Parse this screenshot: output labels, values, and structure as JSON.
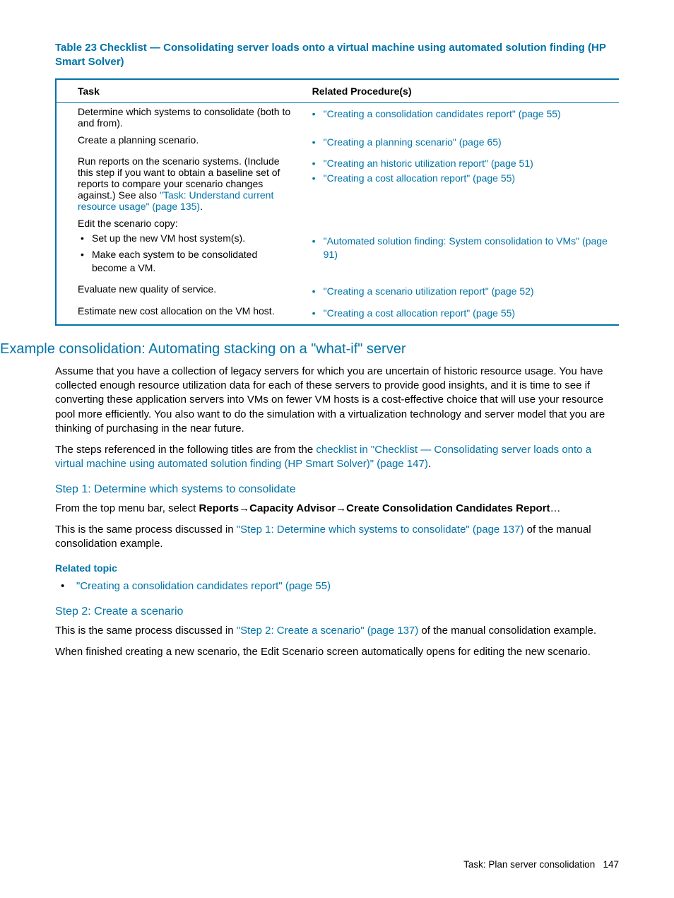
{
  "table": {
    "title": "Table 23 Checklist — Consolidating server loads onto a virtual machine using automated solution finding (HP Smart Solver)",
    "headers": {
      "col1": "Task",
      "col2": "Related Procedure(s)"
    },
    "rows": [
      {
        "task_plain": "Determine which systems to consolidate (both to and from).",
        "procs": [
          {
            "text": "\"Creating a consolidation candidates report\" (page 55)"
          }
        ]
      },
      {
        "task_plain": "Create a planning scenario.",
        "procs": [
          {
            "text": "\"Creating a planning scenario\" (page 65)"
          }
        ]
      },
      {
        "task_pre": "Run reports on the scenario systems. (Include this step if you want to obtain a baseline set of reports to compare your scenario changes against.) See also ",
        "task_link": "\"Task: Understand current resource usage\" (page 135)",
        "task_post": ".",
        "procs": [
          {
            "text": "\"Creating an historic utilization report\" (page 51)"
          },
          {
            "text": "\"Creating a cost allocation report\" (page 55)"
          }
        ]
      },
      {
        "task_plain": "Edit the scenario copy:",
        "sub": [
          "Set up the new VM host system(s).",
          "Make each system to be consolidated become a VM."
        ],
        "procs": [
          {
            "text": "\"Automated solution finding: System consolidation to VMs\" (page 91)"
          }
        ]
      },
      {
        "task_plain": "Evaluate new quality of service.",
        "procs": [
          {
            "text": "\"Creating a scenario utilization report\" (page 52)"
          }
        ]
      },
      {
        "task_plain": "Estimate new cost allocation on the VM host.",
        "procs": [
          {
            "text": "\"Creating a cost allocation report\" (page 55)"
          }
        ]
      }
    ]
  },
  "section": {
    "heading": "Example consolidation: Automating stacking on a \"what-if\" server",
    "intro_p1": "Assume that you have a collection of legacy servers for which you are uncertain of historic resource usage. You have collected enough resource utilization data for each of these servers to provide good insights, and it is time to see if converting these application servers into VMs on fewer VM hosts is a cost-effective choice that will use your resource pool more efficiently. You also want to do the simulation with a virtualization technology and server model that you are thinking of purchasing in the near future.",
    "intro_p2_pre": "The steps referenced in the following titles are from the ",
    "intro_p2_link": "checklist in \"Checklist — Consolidating server loads onto a virtual machine using automated solution finding (HP Smart Solver)\" (page 147)",
    "intro_p2_post": ".",
    "step1": {
      "heading": "Step 1: Determine which systems to consolidate",
      "p1_pre": "From the top menu bar, select ",
      "p1_bold1": "Reports",
      "arrow": "→",
      "p1_bold2": "Capacity Advisor",
      "p1_bold3": "Create Consolidation Candidates Report",
      "p1_post": "…",
      "p2_pre": "This is the same process discussed in ",
      "p2_link": "\"Step 1: Determine which systems to consolidate\" (page 137)",
      "p2_post": " of the manual consolidation example.",
      "related_topic_heading": "Related topic",
      "related_link": "\"Creating a consolidation candidates report\" (page 55)"
    },
    "step2": {
      "heading": "Step 2: Create a scenario",
      "p1_pre": "This is the same process discussed in ",
      "p1_link": "\"Step 2: Create a scenario\" (page 137)",
      "p1_post": " of the manual consolidation example.",
      "p2": "When finished creating a new scenario, the Edit Scenario screen automatically opens for editing the new scenario."
    }
  },
  "footer": {
    "text": "Task: Plan server consolidation",
    "page": "147"
  }
}
